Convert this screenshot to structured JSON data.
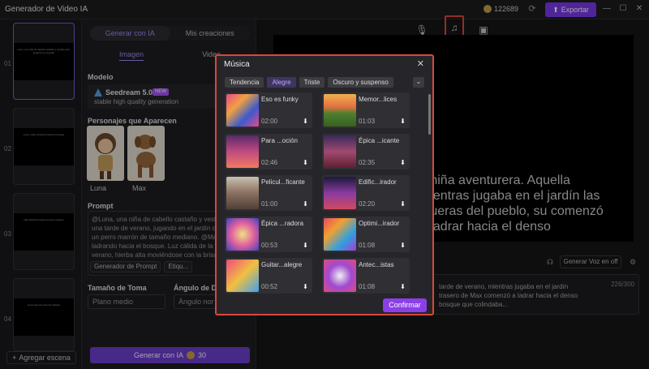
{
  "app": {
    "title": "Generador de Video IA",
    "credits": "122689",
    "export_label": "Exportar"
  },
  "scenes": {
    "numbers": [
      "01",
      "02",
      "03",
      "04"
    ],
    "captions": [
      "Luna, una niña de cabello castaño y vestido azul, jugando en el jardín",
      "Luna y Max corriendo hacia el bosque",
      "Max ladrando hacia el denso bosque",
      "Luna camina entre los árboles"
    ],
    "add_label": "Agregar escena"
  },
  "panel": {
    "tabs": [
      "Generar con IA",
      "Mis creaciones"
    ],
    "subtabs": [
      "Imagen",
      "Video"
    ],
    "model_label": "Modelo",
    "model_name": "Seedream 5.0",
    "model_badge": "NEW",
    "model_desc": "stable high quality generation",
    "characters_label": "Personajes que Aparecen",
    "characters": [
      "Luna",
      "Max"
    ],
    "prompt_label": "Prompt",
    "prompt_text": "@Luna, una niña de cabello castaño y vestido azul, una tarde de verano, jugando en el jardín con @Max, un perro marrón de tamaño mediano. @Max está ladrando hacia el bosque. Luz cálida de la tarde de verano, hierba alta moviéndose con la brisa",
    "prompt_buttons": [
      "Generador de Prompt",
      "Etiqu..."
    ],
    "shot_label": "Tamaño de Toma",
    "shot_value": "Plano medio",
    "angle_label": "Ángulo de Di",
    "angle_value": "Ángulo nor",
    "generate_label": "Generar con IA",
    "generate_cost": "30"
  },
  "preview": {
    "text": "a niña aventurera. Aquella mientras jugaba en el jardín las afueras del pueblo, su comenzó a ladrar hacia el denso",
    "voice_button": "Generar Voz en off",
    "narration": "tarde de verano, mientras jugaba en el jardín trasero de Max comenzó a ladrar hacia el denso bosque que colindaba...",
    "narration_count": "226/300"
  },
  "music_modal": {
    "title": "Música",
    "filters": [
      "Tendencia",
      "Alegre",
      "Triste",
      "Oscuro y suspenso"
    ],
    "active_filter": "Alegre",
    "tracks": [
      {
        "name": "Eso es funky",
        "duration": "02:00"
      },
      {
        "name": "Memor...lices",
        "duration": "01:03"
      },
      {
        "name": "Para ...oción",
        "duration": "02:46"
      },
      {
        "name": "Épica ...icante",
        "duration": "02:35"
      },
      {
        "name": "Pelicul...ficante",
        "duration": "01:00"
      },
      {
        "name": "Edific...irador",
        "duration": "02:20"
      },
      {
        "name": "Épica ...radora",
        "duration": "00:53"
      },
      {
        "name": "Optimi...irador",
        "duration": "01:08"
      },
      {
        "name": "Guitar...alegre",
        "duration": "00:52"
      },
      {
        "name": "Antec...istas",
        "duration": "01:08"
      }
    ],
    "confirm_label": "Confirmar"
  },
  "colors": {
    "accent": "#7c3aed",
    "highlight": "#d9473a"
  }
}
